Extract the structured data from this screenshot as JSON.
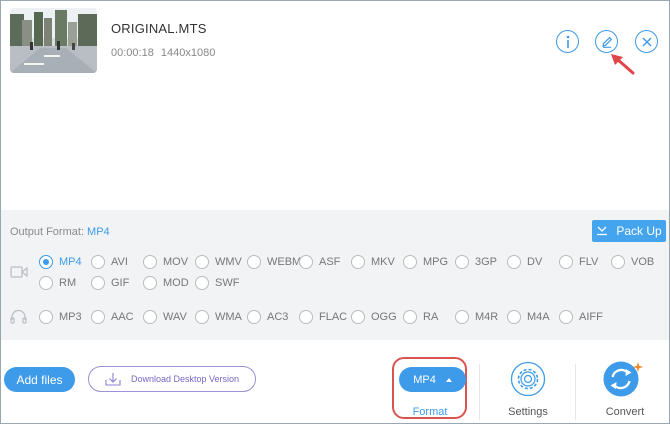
{
  "file": {
    "name": "ORIGINAL.MTS",
    "duration": "00:00:18",
    "resolution": "1440x1080"
  },
  "actions": {
    "info_icon": "info-icon",
    "edit_icon": "pencil-icon",
    "remove_icon": "close-icon"
  },
  "output": {
    "label": "Output Format:",
    "value": "MP4",
    "pack_up": "Pack Up"
  },
  "video_formats": [
    "MP4",
    "AVI",
    "MOV",
    "WMV",
    "WEBM",
    "ASF",
    "MKV",
    "MPG",
    "3GP",
    "DV",
    "FLV",
    "VOB",
    "RM",
    "GIF",
    "MOD",
    "SWF"
  ],
  "audio_formats": [
    "MP3",
    "AAC",
    "WAV",
    "WMA",
    "AC3",
    "FLAC",
    "OGG",
    "RA",
    "M4R",
    "M4A",
    "AIFF"
  ],
  "selected_format": "MP4",
  "bottom": {
    "add_files": "Add files",
    "download": "Download Desktop Version",
    "format_value": "MP4",
    "format_label": "Format",
    "settings_label": "Settings",
    "convert_label": "Convert"
  },
  "colors": {
    "accent": "#3d9be9",
    "highlight": "#d9534f",
    "download_border": "#9e8fd8",
    "convert_spark": "#f08a2a"
  }
}
